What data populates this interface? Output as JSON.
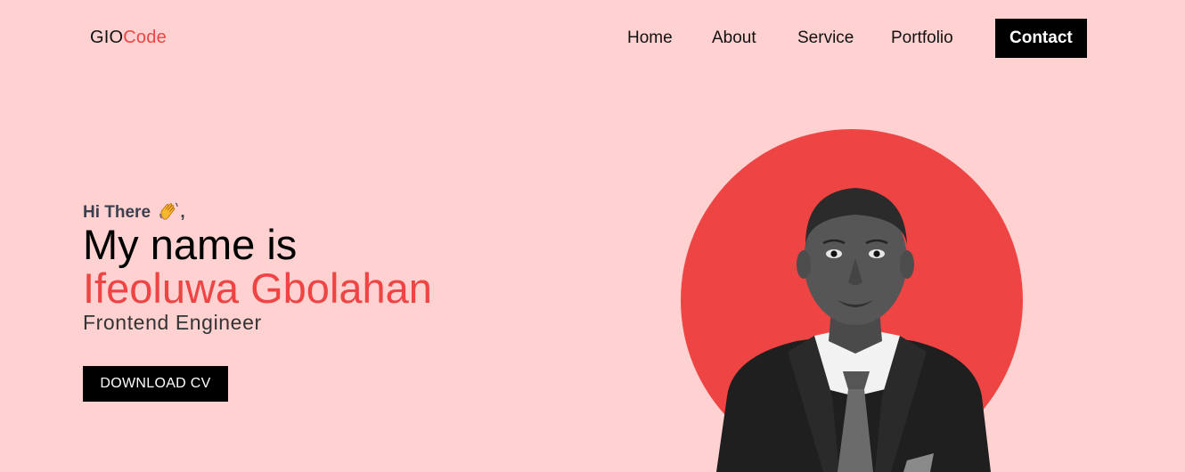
{
  "header": {
    "logo_prefix": "GIO",
    "logo_suffix": "Code",
    "nav": {
      "home": "Home",
      "about": "About",
      "service": "Service",
      "portfolio": "Portfolio",
      "contact": "Contact"
    }
  },
  "hero": {
    "greeting": "Hi There",
    "greeting_punct": ",",
    "greeting_icon": "waving-hand-icon",
    "headline": "My name is",
    "name": "Ifeoluwa Gbolahan",
    "role": "Frontend Engineer",
    "cta_label": "DOWNLOAD CV"
  },
  "colors": {
    "background": "#ffd1d0",
    "accent": "#ef4444",
    "dark": "#000000"
  }
}
